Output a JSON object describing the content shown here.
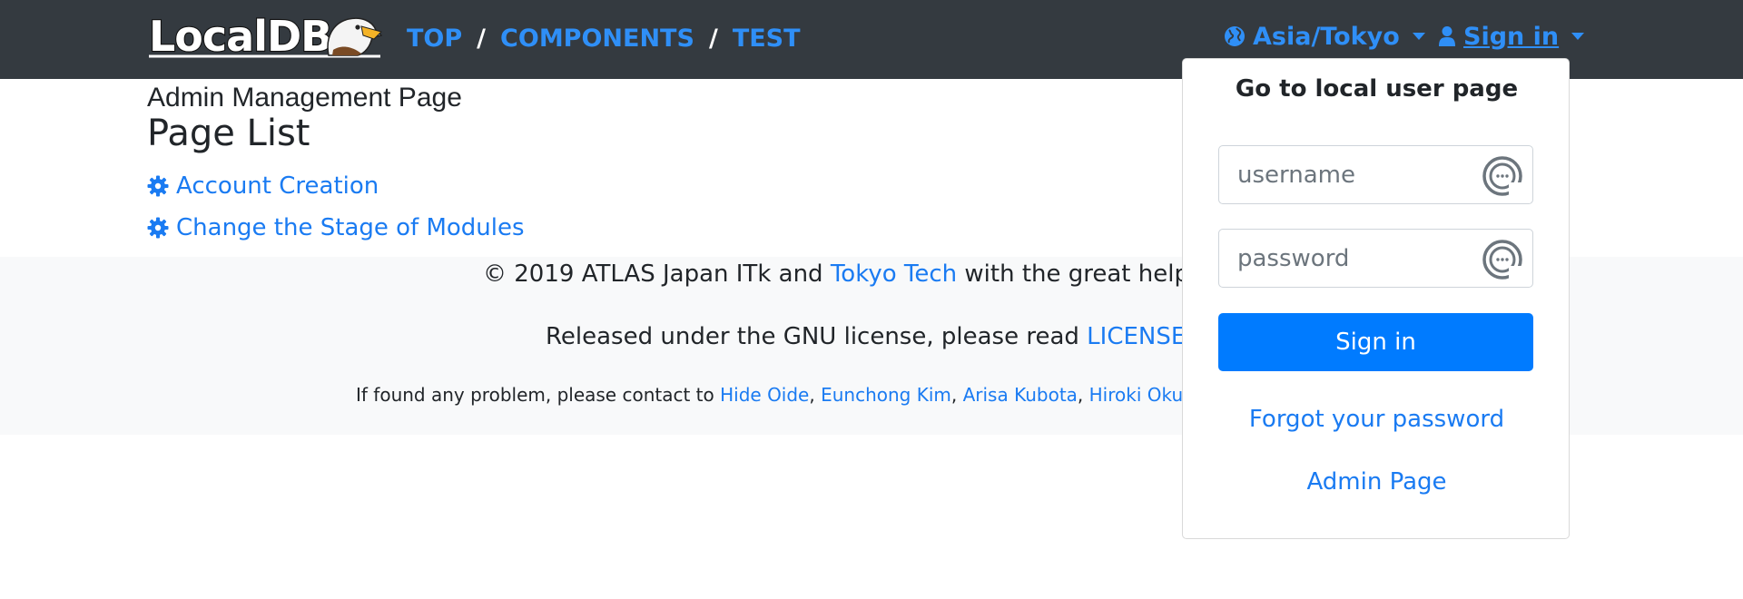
{
  "navbar": {
    "logo_text": "LocalDB",
    "breadcrumb": [
      {
        "label": "TOP"
      },
      {
        "label": "COMPONENTS"
      },
      {
        "label": "TEST"
      }
    ],
    "separator": "/",
    "timezone": "Asia/Tokyo",
    "signin_label": "Sign in",
    "icons": {
      "timezone": "globe-icon",
      "signin": "user-icon",
      "dropdown": "caret-down-icon"
    }
  },
  "main": {
    "admin_title": "Admin Management Page",
    "page_title": "Page List",
    "links": [
      {
        "label": "Account Creation",
        "icon": "gear-icon"
      },
      {
        "label": "Change the Stage of Modules",
        "icon": "gear-icon"
      }
    ]
  },
  "footer": {
    "line1_prefix": "© 2019 ATLAS Japan ITk and ",
    "line1_link": "Tokyo Tech",
    "line1_suffix": " with the great help of",
    "line2_prefix": "Released under the GNU license, please read ",
    "line2_link": "LICENSE.TXT",
    "line3_prefix": "If found any problem, please contact to ",
    "contacts": [
      "Hide Oide",
      "Eunchong Kim",
      "Arisa Kubota",
      "Hiroki Okuyama"
    ],
    "contact_sep": ", "
  },
  "signin_dropdown": {
    "title": "Go to local user page",
    "username_placeholder": "username",
    "password_placeholder": "password",
    "submit_label": "Sign in",
    "forgot_label": "Forgot your password",
    "admin_label": "Admin Page",
    "field_icon": "password-manager-icon"
  },
  "colors": {
    "navbar_bg": "#343a40",
    "link": "#1a7bf2",
    "primary_button": "#007bff",
    "footer_bg": "#f8f9fa"
  }
}
